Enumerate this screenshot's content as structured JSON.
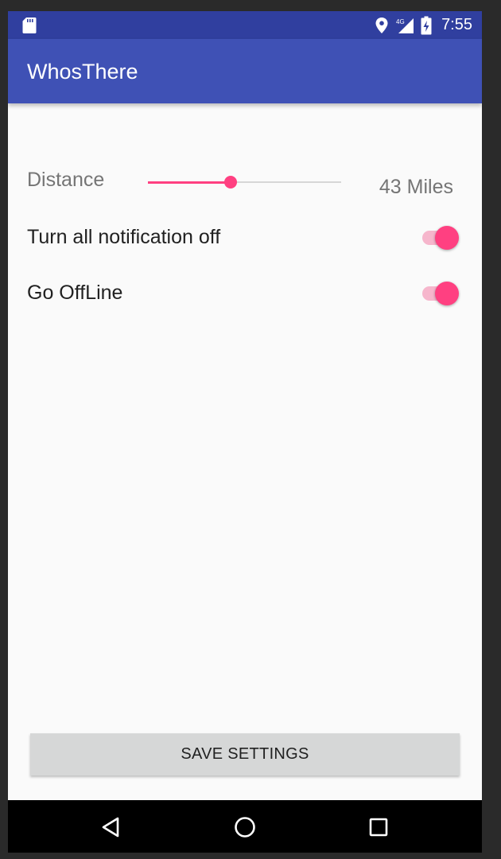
{
  "status_bar": {
    "time": "7:55",
    "network_label": "4G",
    "icons": [
      "sd-card-icon",
      "location-pin-icon",
      "signal-4g-icon",
      "battery-charging-icon"
    ],
    "color": "#303f9f"
  },
  "app_bar": {
    "title": "WhosThere",
    "color": "#3f51b5"
  },
  "settings": {
    "distance": {
      "label": "Distance",
      "value_text": "43 Miles",
      "slider_level": 0.43
    },
    "notifications": {
      "label": "Turn all notification off",
      "on": true
    },
    "offline": {
      "label": "Go OffLine",
      "on": true
    },
    "accent_color": "#ff4081"
  },
  "save_button": {
    "label": "SAVE SETTINGS"
  },
  "nav_bar": {
    "icons": [
      "back-icon",
      "home-icon",
      "recents-icon"
    ]
  }
}
